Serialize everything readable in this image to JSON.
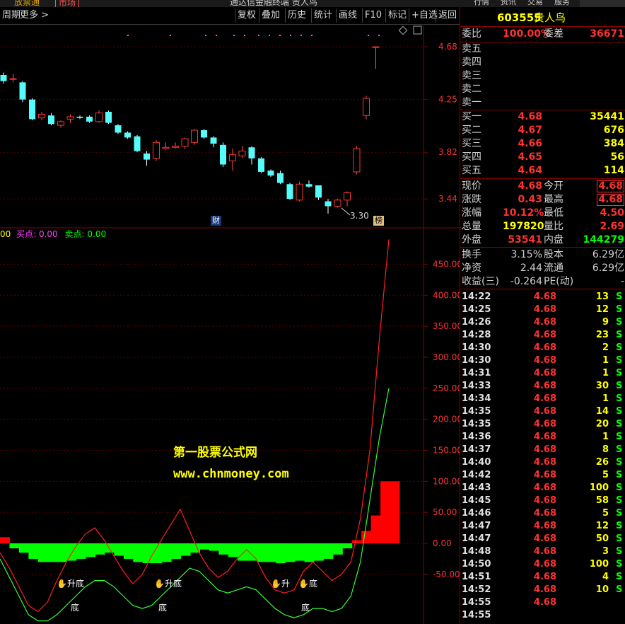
{
  "top_strip": {
    "left_text": "放票通",
    "tab_text": "市场",
    "center_title": "通达信金融终端 贵人鸟",
    "right_tabs": [
      "行情",
      "资讯",
      "交易",
      "服务"
    ]
  },
  "toolbar": {
    "period": "周期",
    "more": "更多",
    "buttons": [
      "复权",
      "叠加",
      "历史",
      "统计",
      "画线",
      "F10",
      "标记",
      "+自选",
      "返回"
    ]
  },
  "indicator_label": {
    "prefix": "00",
    "buy": "买点: 0.00",
    "sell": "卖点: 0.00"
  },
  "badges": {
    "cai": "财",
    "bang": "榜"
  },
  "low_marker": "3.30",
  "signals": {
    "rise_bottom": "升底",
    "bottom": "底",
    "rise": "升"
  },
  "watermark": {
    "line1": "第一股票公式网",
    "line2": "www.chnmoney.com"
  },
  "colors": {
    "up": "#ff3232",
    "down": "#54fcfc",
    "grid": "#8b0000",
    "volume_up": "#ff0000",
    "volume_down": "#00ff00",
    "yellow": "#ffff00"
  },
  "stock": {
    "code": "603555",
    "name": "贵人鸟"
  },
  "order_ratio": {
    "weibi_label": "委比",
    "weibi": "100.00%",
    "weicha_label": "委差",
    "weicha": "36671"
  },
  "sell_levels": [
    {
      "label": "卖五",
      "price": "",
      "vol": ""
    },
    {
      "label": "卖四",
      "price": "",
      "vol": ""
    },
    {
      "label": "卖三",
      "price": "",
      "vol": ""
    },
    {
      "label": "卖二",
      "price": "",
      "vol": ""
    },
    {
      "label": "卖一",
      "price": "",
      "vol": ""
    }
  ],
  "buy_levels": [
    {
      "label": "买一",
      "price": "4.68",
      "vol": "35441"
    },
    {
      "label": "买二",
      "price": "4.67",
      "vol": "676"
    },
    {
      "label": "买三",
      "price": "4.66",
      "vol": "384"
    },
    {
      "label": "买四",
      "price": "4.65",
      "vol": "56"
    },
    {
      "label": "买五",
      "price": "4.64",
      "vol": "114"
    }
  ],
  "quote": [
    {
      "l1": "现价",
      "v1": "4.68",
      "l2": "今开",
      "v2": "4.68"
    },
    {
      "l1": "涨跌",
      "v1": "0.43",
      "l2": "最高",
      "v2": "4.68"
    },
    {
      "l1": "涨幅",
      "v1": "10.12%",
      "l2": "最低",
      "v2": "4.50"
    },
    {
      "l1": "总量",
      "v1": "197820",
      "l2": "量比",
      "v2": "2.69"
    },
    {
      "l1": "外盘",
      "v1": "53541",
      "l2": "内盘",
      "v2": "144279"
    }
  ],
  "stats": [
    {
      "l1": "换手",
      "v1": "3.15%",
      "l2": "股本",
      "v2": "6.29亿"
    },
    {
      "l1": "净资",
      "v1": "2.44",
      "l2": "流通",
      "v2": "6.29亿"
    },
    {
      "l1": "收益(三)",
      "v1": "-0.264",
      "l2": "PE(动)",
      "v2": "-"
    }
  ],
  "trades": [
    {
      "t": "14:22",
      "p": "4.68",
      "v": "13",
      "s": "S"
    },
    {
      "t": "14:25",
      "p": "4.68",
      "v": "12",
      "s": "S"
    },
    {
      "t": "14:26",
      "p": "4.68",
      "v": "9",
      "s": "S"
    },
    {
      "t": "14:28",
      "p": "4.68",
      "v": "23",
      "s": "S"
    },
    {
      "t": "14:30",
      "p": "4.68",
      "v": "2",
      "s": "S"
    },
    {
      "t": "14:30",
      "p": "4.68",
      "v": "1",
      "s": "S"
    },
    {
      "t": "14:31",
      "p": "4.68",
      "v": "1",
      "s": "S"
    },
    {
      "t": "14:33",
      "p": "4.68",
      "v": "30",
      "s": "S"
    },
    {
      "t": "14:34",
      "p": "4.68",
      "v": "1",
      "s": "S"
    },
    {
      "t": "14:35",
      "p": "4.68",
      "v": "14",
      "s": "S"
    },
    {
      "t": "14:35",
      "p": "4.68",
      "v": "20",
      "s": "S"
    },
    {
      "t": "14:36",
      "p": "4.68",
      "v": "1",
      "s": "S"
    },
    {
      "t": "14:37",
      "p": "4.68",
      "v": "8",
      "s": "S"
    },
    {
      "t": "14:40",
      "p": "4.68",
      "v": "26",
      "s": "S"
    },
    {
      "t": "14:42",
      "p": "4.68",
      "v": "5",
      "s": "S"
    },
    {
      "t": "14:43",
      "p": "4.68",
      "v": "100",
      "s": "S"
    },
    {
      "t": "14:45",
      "p": "4.68",
      "v": "58",
      "s": "S"
    },
    {
      "t": "14:46",
      "p": "4.68",
      "v": "5",
      "s": "S"
    },
    {
      "t": "14:47",
      "p": "4.68",
      "v": "12",
      "s": "S"
    },
    {
      "t": "14:47",
      "p": "4.68",
      "v": "50",
      "s": "S"
    },
    {
      "t": "14:48",
      "p": "4.68",
      "v": "3",
      "s": "S"
    },
    {
      "t": "14:50",
      "p": "4.68",
      "v": "100",
      "s": "S"
    },
    {
      "t": "14:51",
      "p": "4.68",
      "v": "4",
      "s": "S"
    },
    {
      "t": "14:52",
      "p": "4.68",
      "v": "10",
      "s": "S"
    },
    {
      "t": "14:55",
      "p": "4.68",
      "v": "",
      "s": ""
    },
    {
      "t": "14:55",
      "p": "",
      "v": "",
      "s": ""
    }
  ],
  "chart_data": [
    {
      "type": "candlestick",
      "title": "",
      "y_ticks": [
        "4.68",
        "4.25",
        "3.82",
        "3.44"
      ],
      "ylim": [
        3.25,
        4.75
      ],
      "candles": [
        {
          "o": 4.45,
          "c": 4.4,
          "h": 4.47,
          "l": 4.38
        },
        {
          "o": 4.42,
          "c": 4.42,
          "h": 4.46,
          "l": 4.39
        },
        {
          "o": 4.39,
          "c": 4.25,
          "h": 4.4,
          "l": 4.23
        },
        {
          "o": 4.25,
          "c": 4.09,
          "h": 4.26,
          "l": 4.08
        },
        {
          "o": 4.1,
          "c": 4.13,
          "h": 4.15,
          "l": 4.08
        },
        {
          "o": 4.12,
          "c": 4.05,
          "h": 4.14,
          "l": 4.04
        },
        {
          "o": 4.04,
          "c": 4.07,
          "h": 4.08,
          "l": 4.02
        },
        {
          "o": 4.09,
          "c": 4.11,
          "h": 4.13,
          "l": 4.06
        },
        {
          "o": 4.11,
          "c": 4.1,
          "h": 4.12,
          "l": 4.09
        },
        {
          "o": 4.11,
          "c": 4.07,
          "h": 4.12,
          "l": 4.06
        },
        {
          "o": 4.07,
          "c": 4.14,
          "h": 4.16,
          "l": 4.06
        },
        {
          "o": 4.15,
          "c": 4.06,
          "h": 4.16,
          "l": 4.05
        },
        {
          "o": 4.04,
          "c": 3.98,
          "h": 4.05,
          "l": 3.97
        },
        {
          "o": 3.98,
          "c": 3.94,
          "h": 3.99,
          "l": 3.93
        },
        {
          "o": 3.95,
          "c": 3.83,
          "h": 3.96,
          "l": 3.82
        },
        {
          "o": 3.81,
          "c": 3.76,
          "h": 3.83,
          "l": 3.71
        },
        {
          "o": 3.77,
          "c": 3.9,
          "h": 3.92,
          "l": 3.75
        },
        {
          "o": 3.85,
          "c": 3.86,
          "h": 3.9,
          "l": 3.84
        },
        {
          "o": 3.86,
          "c": 3.87,
          "h": 3.9,
          "l": 3.85
        },
        {
          "o": 3.87,
          "c": 3.93,
          "h": 3.94,
          "l": 3.85
        },
        {
          "o": 3.9,
          "c": 4.0,
          "h": 4.01,
          "l": 3.88
        },
        {
          "o": 4.0,
          "c": 3.94,
          "h": 4.01,
          "l": 3.93
        },
        {
          "o": 3.94,
          "c": 3.89,
          "h": 3.95,
          "l": 3.86
        },
        {
          "o": 3.88,
          "c": 3.72,
          "h": 3.9,
          "l": 3.7
        },
        {
          "o": 3.75,
          "c": 3.8,
          "h": 3.85,
          "l": 3.67
        },
        {
          "o": 3.79,
          "c": 3.83,
          "h": 3.87,
          "l": 3.77
        },
        {
          "o": 3.86,
          "c": 3.77,
          "h": 3.87,
          "l": 3.72
        },
        {
          "o": 3.77,
          "c": 3.66,
          "h": 3.78,
          "l": 3.65
        },
        {
          "o": 3.67,
          "c": 3.63,
          "h": 3.68,
          "l": 3.62
        },
        {
          "o": 3.65,
          "c": 3.57,
          "h": 3.67,
          "l": 3.56
        },
        {
          "o": 3.56,
          "c": 3.44,
          "h": 3.57,
          "l": 3.43
        },
        {
          "o": 3.43,
          "c": 3.56,
          "h": 3.58,
          "l": 3.42
        },
        {
          "o": 3.56,
          "c": 3.54,
          "h": 3.59,
          "l": 3.53
        },
        {
          "o": 3.55,
          "c": 3.45,
          "h": 3.55,
          "l": 3.43
        },
        {
          "o": 3.42,
          "c": 3.38,
          "h": 3.44,
          "l": 3.32
        },
        {
          "o": 3.38,
          "c": 3.43,
          "h": 3.44,
          "l": 3.37
        },
        {
          "o": 3.43,
          "c": 3.49,
          "h": 3.5,
          "l": 3.38
        },
        {
          "o": 3.66,
          "c": 3.85,
          "h": 3.87,
          "l": 3.64
        },
        {
          "o": 4.12,
          "c": 4.26,
          "h": 4.28,
          "l": 4.09
        },
        {
          "o": 4.68,
          "c": 4.68,
          "h": 4.68,
          "l": 4.5
        }
      ]
    },
    {
      "type": "indicator",
      "title": "",
      "y_ticks": [
        "450.00",
        "400.00",
        "350.00",
        "300.00",
        "250.00",
        "200.00",
        "150.00",
        "100.00",
        "50.00",
        "0.00",
        "-50.00"
      ],
      "ylim": [
        -130,
        495
      ],
      "bars": [
        10,
        -8,
        -15,
        -25,
        -30,
        -30,
        -30,
        -28,
        -25,
        -22,
        -18,
        -15,
        -20,
        -25,
        -30,
        -32,
        -32,
        -30,
        -25,
        -20,
        -15,
        -10,
        -12,
        -18,
        -22,
        -28,
        -28,
        -30,
        -30,
        -32,
        -30,
        -28,
        -30,
        -28,
        -25,
        -18,
        -8,
        5,
        20,
        45,
        100,
        100
      ],
      "red_line": [
        -15,
        -40,
        -70,
        -100,
        -110,
        -95,
        -60,
        -30,
        -5,
        15,
        25,
        5,
        -20,
        -45,
        -65,
        -50,
        -20,
        5,
        30,
        55,
        20,
        -15,
        -40,
        -55,
        -45,
        -25,
        -10,
        -25,
        -55,
        -75,
        -80,
        -75,
        -45,
        -30,
        -45,
        -60,
        -50,
        -30,
        40,
        150,
        330,
        490
      ],
      "green_line": [
        -25,
        -55,
        -85,
        -115,
        -125,
        -125,
        -115,
        -100,
        -85,
        -70,
        -60,
        -60,
        -70,
        -85,
        -100,
        -105,
        -100,
        -85,
        -70,
        -55,
        -40,
        -45,
        -60,
        -75,
        -80,
        -75,
        -70,
        -75,
        -90,
        -105,
        -115,
        -120,
        -115,
        -105,
        -105,
        -110,
        -105,
        -85,
        -30,
        70,
        170,
        250
      ]
    }
  ]
}
